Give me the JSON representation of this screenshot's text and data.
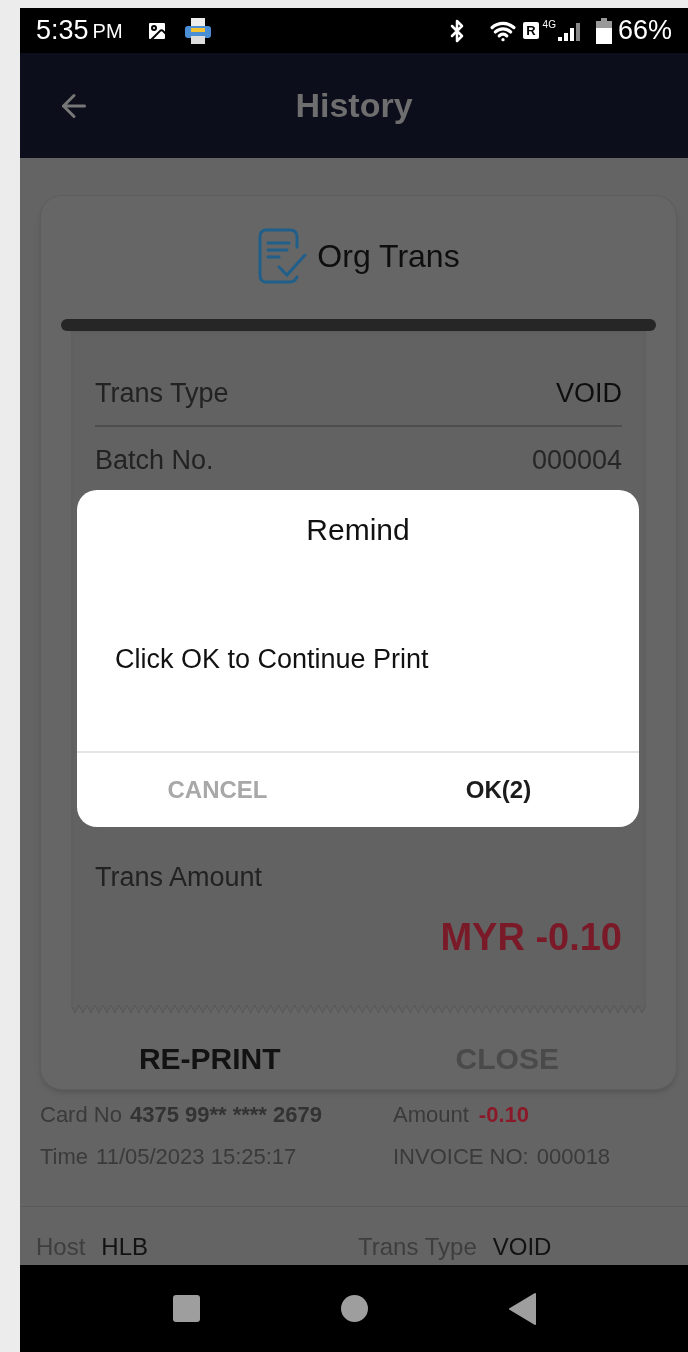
{
  "status_bar": {
    "time": "5:35",
    "ampm": "PM",
    "roaming": "R",
    "network": "4G",
    "battery": "66%"
  },
  "app_bar": {
    "title": "History"
  },
  "receipt_card": {
    "title": "Org Trans",
    "rows": [
      {
        "label": "Trans Type",
        "value": "VOID"
      },
      {
        "label": "Batch No.",
        "value": "000004"
      }
    ],
    "amount_label": "Trans Amount",
    "amount": "MYR -0.10",
    "buttons": [
      {
        "label": "RE-PRINT",
        "disabled": false
      },
      {
        "label": "CLOSE",
        "disabled": true
      }
    ]
  },
  "history_item": {
    "card_no_label": "Card No",
    "card_no": "4375 99** **** 2679",
    "amount_label": "Amount",
    "amount": "-0.10",
    "time_label": "Time",
    "time": "11/05/2023 15:25:17",
    "invoice_label": "INVOICE NO:",
    "invoice": "000018"
  },
  "next_item": {
    "host_label": "Host",
    "host": "HLB",
    "type_label": "Trans Type",
    "type": "VOID"
  },
  "dialog": {
    "title": "Remind",
    "message": "Click OK to Continue Print",
    "buttons": [
      {
        "label": "CANCEL",
        "kind": "cancel"
      },
      {
        "label": "OK(2)",
        "kind": "confirm"
      }
    ]
  }
}
